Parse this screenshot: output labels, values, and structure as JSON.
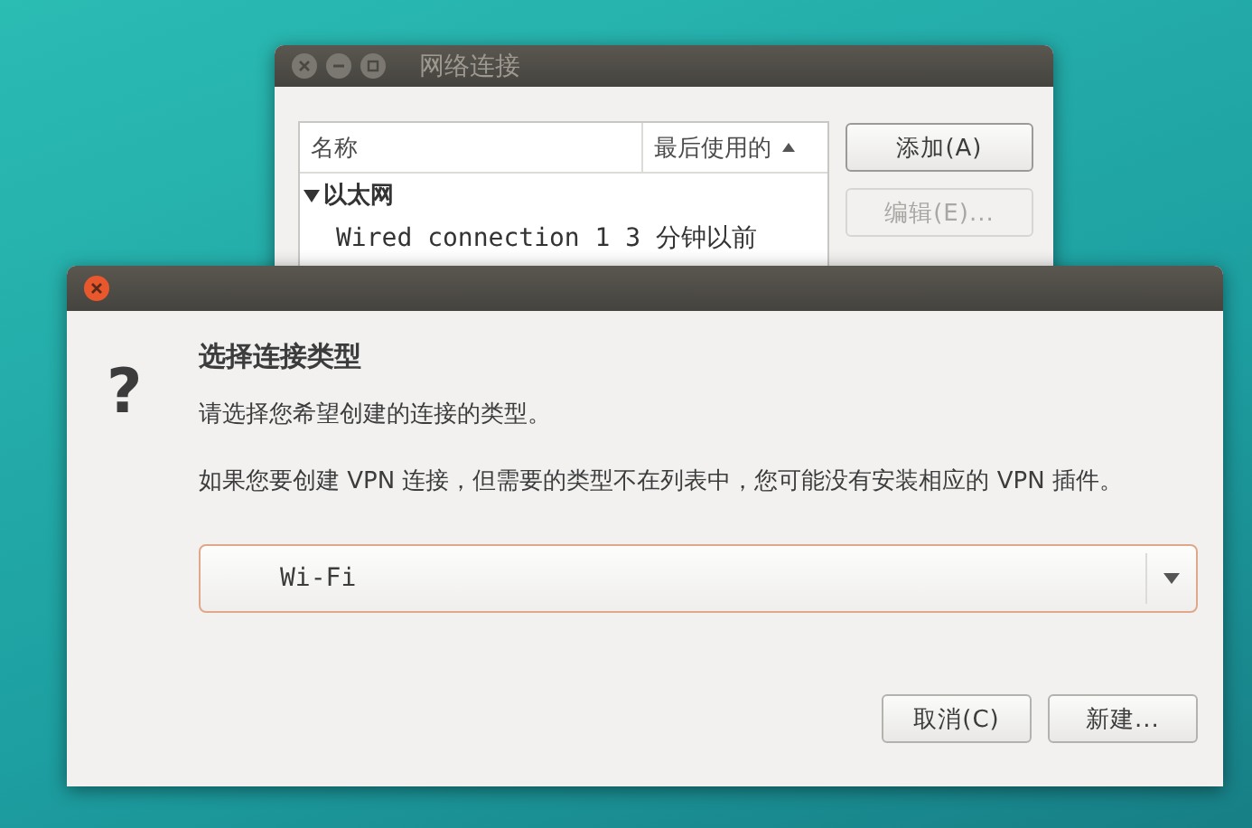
{
  "back_window": {
    "title": "网络连接",
    "list": {
      "columns": [
        {
          "label": "名称",
          "sorted": false
        },
        {
          "label": "最后使用的",
          "sorted": true
        }
      ],
      "groups": [
        {
          "label": "以太网",
          "expanded": true,
          "children": [
            {
              "name": "Wired connection 1",
              "last_used": "3 分钟以前"
            }
          ]
        }
      ]
    },
    "buttons": [
      {
        "label": "添加(A)",
        "disabled": false
      },
      {
        "label": "编辑(E)...",
        "disabled": true
      }
    ]
  },
  "dialog": {
    "icon": "?",
    "heading": "选择连接类型",
    "message": "请选择您希望创建的连接的类型。",
    "note": "如果您要创建 VPN 连接，但需要的类型不在列表中，您可能没有安装相应的 VPN 插件。",
    "connection_type": {
      "value": "Wi-Fi"
    },
    "buttons": [
      {
        "label": "取消(C)"
      },
      {
        "label": "新建..."
      }
    ]
  }
}
